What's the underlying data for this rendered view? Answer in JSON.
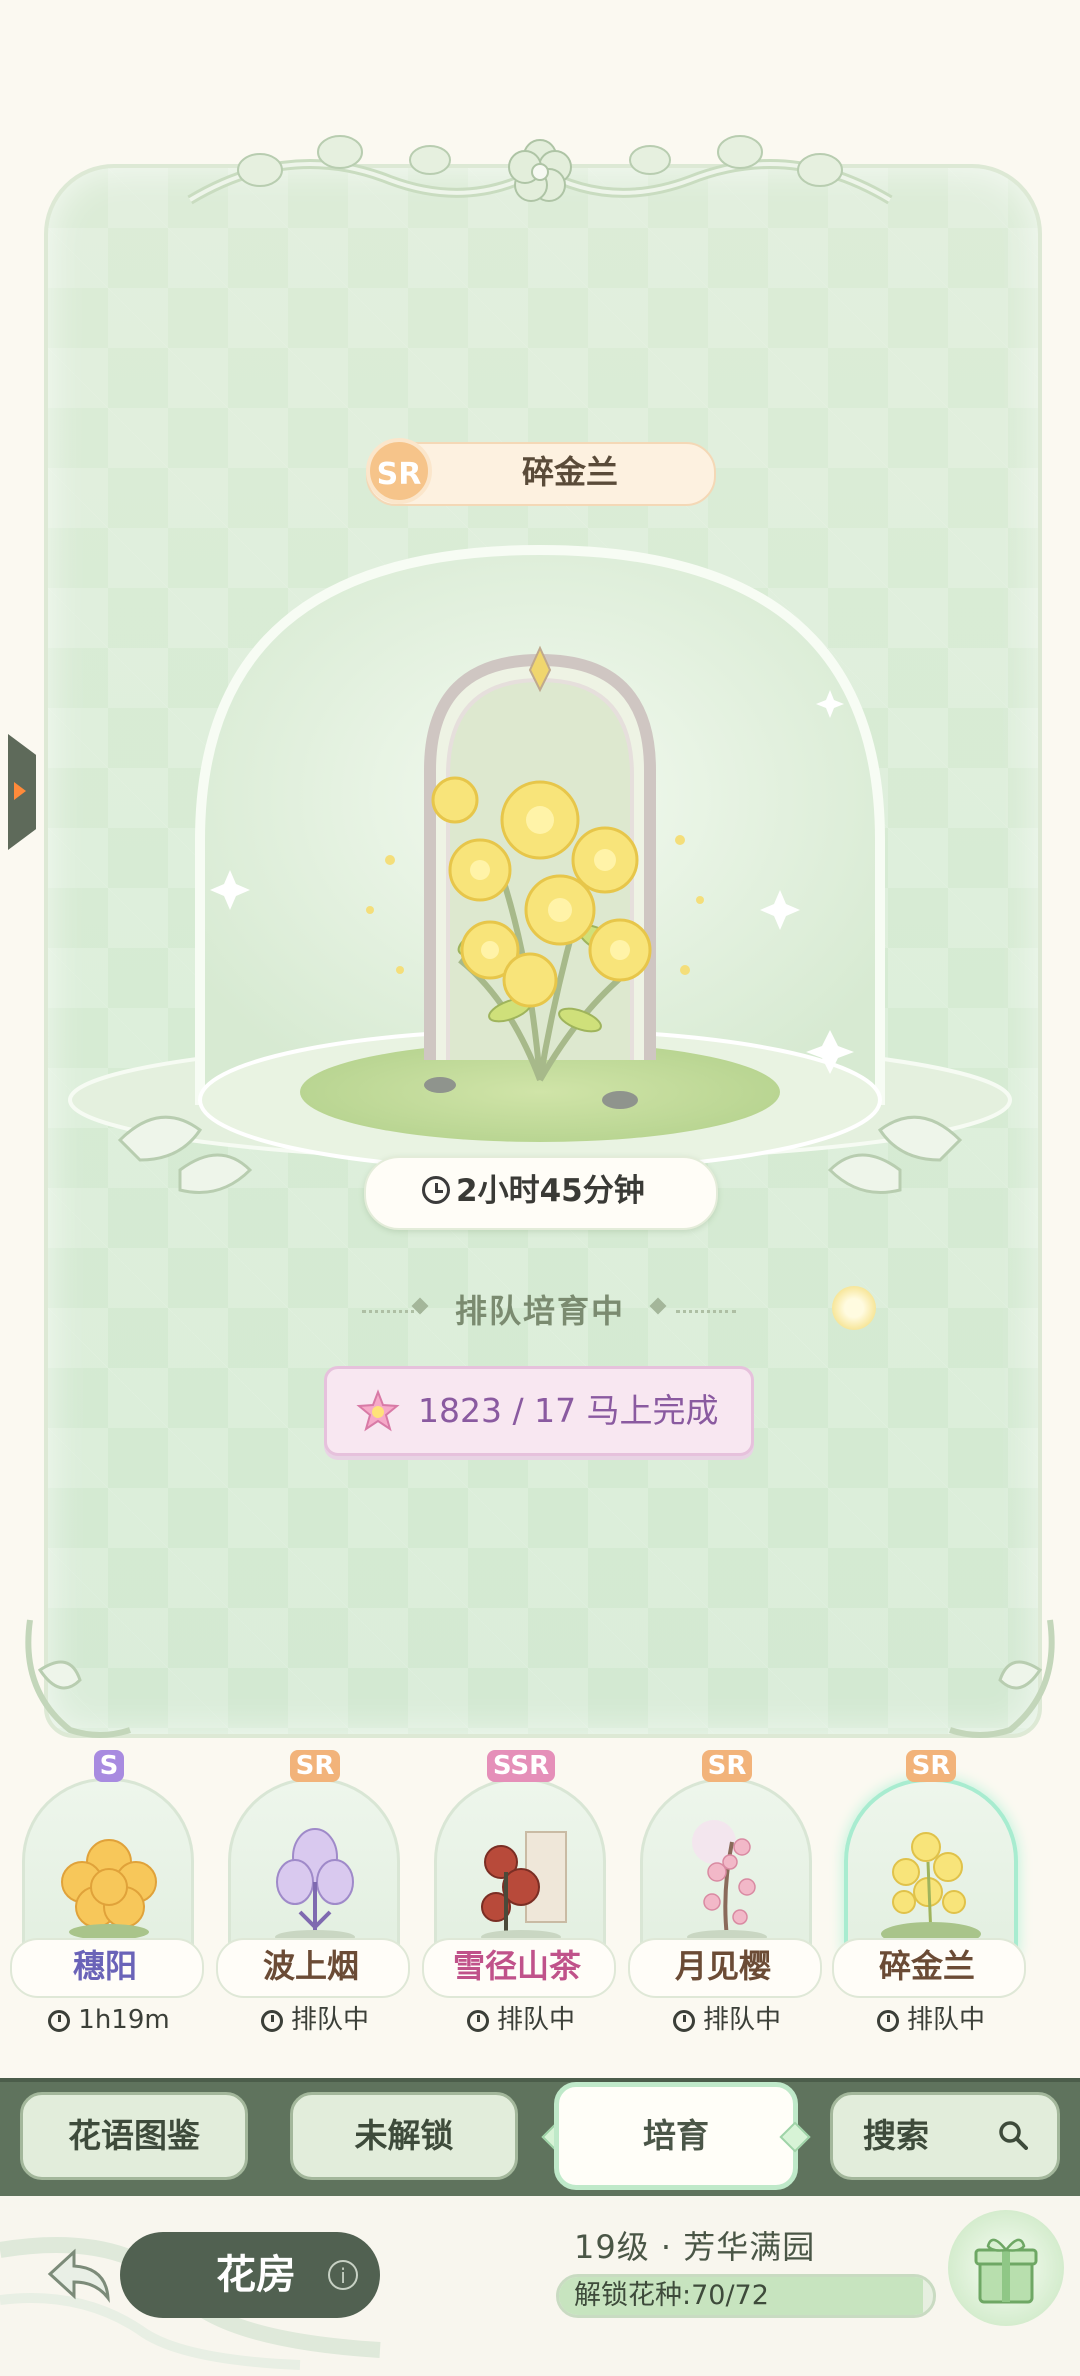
{
  "featured": {
    "rarity": "SR",
    "name": "碎金兰",
    "timer": "2小时45分钟",
    "status": "排队培育中",
    "finish_button": "1823 / 17 马上完成"
  },
  "cards": [
    {
      "rarity": "S",
      "name": "穗阳",
      "status": "1h19m",
      "rarity_color": "#a88be0",
      "name_color": "#6a63b8"
    },
    {
      "rarity": "SR",
      "name": "波上烟",
      "status": "排队中",
      "rarity_color": "#f2b37a",
      "name_color": "#6b4b35"
    },
    {
      "rarity": "SSR",
      "name": "雪径山茶",
      "status": "排队中",
      "rarity_color": "#e58fb9",
      "name_color": "#c0528a"
    },
    {
      "rarity": "SR",
      "name": "月见樱",
      "status": "排队中",
      "rarity_color": "#f2b37a",
      "name_color": "#6b4b35"
    },
    {
      "rarity": "SR",
      "name": "碎金兰",
      "status": "排队中",
      "rarity_color": "#f2b37a",
      "name_color": "#6b4b35"
    }
  ],
  "tabs": {
    "catalog": "花语图鉴",
    "locked": "未解锁",
    "breeding": "培育",
    "search": "搜索"
  },
  "footer": {
    "house": "花房",
    "level": "19级 · 芳华满园",
    "unlock": "解锁花种:70/72",
    "unlock_progress": 0.972
  },
  "colors": {
    "panel": "#d6ebd3",
    "tabbar": "#5f735d",
    "accent_pink": "#8a5aa0"
  }
}
